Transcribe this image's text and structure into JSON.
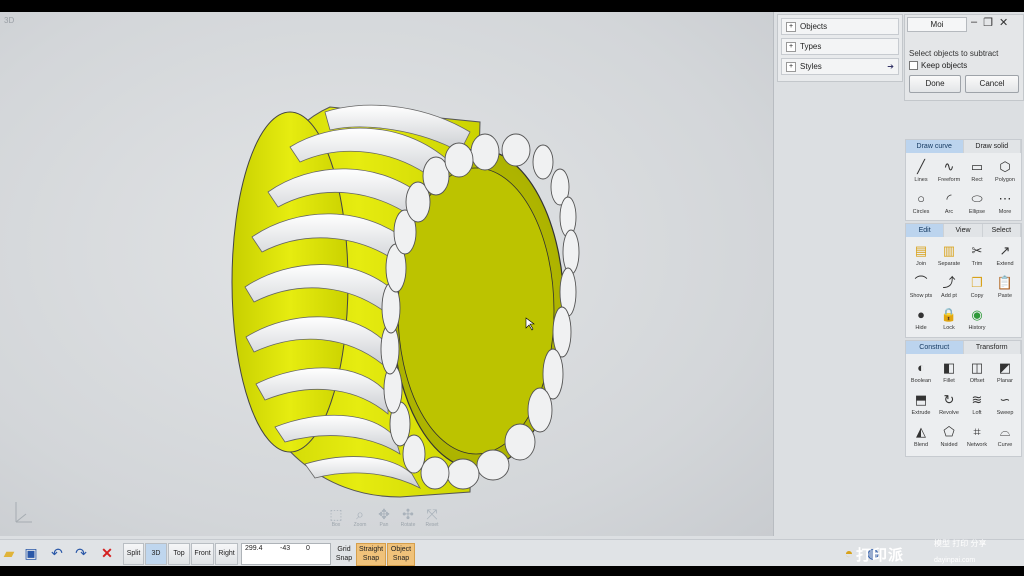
{
  "viewport": {
    "label": "3D",
    "nav_tools": [
      {
        "icon": "zoom-box-icon",
        "label": "Box"
      },
      {
        "icon": "zoom-icon",
        "label": "Zoom"
      },
      {
        "icon": "pan-icon",
        "label": "Pan"
      },
      {
        "icon": "rotate-icon",
        "label": "Rotate"
      },
      {
        "icon": "reset-icon",
        "label": "Reset"
      }
    ]
  },
  "browser": {
    "items": [
      {
        "label": "Objects"
      },
      {
        "label": "Types"
      },
      {
        "label": "Styles"
      }
    ]
  },
  "command": {
    "title": "Moi",
    "prompt": "Select objects to subtract",
    "keep_label": "Keep objects",
    "done_label": "Done",
    "cancel_label": "Cancel"
  },
  "draw": {
    "tabs": [
      "Draw curve",
      "Draw solid"
    ],
    "tools": [
      {
        "label": "Lines",
        "glyph": "╱"
      },
      {
        "label": "Freeform",
        "glyph": "∿"
      },
      {
        "label": "Rect",
        "glyph": "▭"
      },
      {
        "label": "Polygon",
        "glyph": "⬡"
      },
      {
        "label": "Circles",
        "glyph": "○"
      },
      {
        "label": "Arc",
        "glyph": "◜"
      },
      {
        "label": "Ellipse",
        "glyph": "⬭"
      },
      {
        "label": "More",
        "glyph": "⋯"
      }
    ]
  },
  "edit": {
    "tabs": [
      "Edit",
      "View",
      "Select"
    ],
    "tools": [
      {
        "label": "Join",
        "glyph": "▤"
      },
      {
        "label": "Separate",
        "glyph": "▥"
      },
      {
        "label": "Trim",
        "glyph": "✂"
      },
      {
        "label": "Extend",
        "glyph": "↗"
      },
      {
        "label": "Show pts",
        "glyph": "⌒"
      },
      {
        "label": "Add pt",
        "glyph": "⤴"
      },
      {
        "label": "Copy",
        "glyph": "❐"
      },
      {
        "label": "Paste",
        "glyph": "📋"
      },
      {
        "label": "Hide",
        "glyph": "●"
      },
      {
        "label": "Lock",
        "glyph": "🔒"
      },
      {
        "label": "History",
        "glyph": "◉"
      }
    ]
  },
  "construct": {
    "tabs": [
      "Construct",
      "Transform"
    ],
    "tools": [
      {
        "label": "Boolean",
        "glyph": "◐"
      },
      {
        "label": "Fillet",
        "glyph": "◧"
      },
      {
        "label": "Offset",
        "glyph": "◫"
      },
      {
        "label": "Planar",
        "glyph": "◩"
      },
      {
        "label": "Extrude",
        "glyph": "⬒"
      },
      {
        "label": "Revolve",
        "glyph": "↻"
      },
      {
        "label": "Loft",
        "glyph": "≋"
      },
      {
        "label": "Sweep",
        "glyph": "∽"
      },
      {
        "label": "Blend",
        "glyph": "◭"
      },
      {
        "label": "Nsided",
        "glyph": "⬠"
      },
      {
        "label": "Network",
        "glyph": "⌗"
      },
      {
        "label": "Curve",
        "glyph": "⌓"
      }
    ]
  },
  "statusbar": {
    "views": [
      "Split",
      "3D",
      "Top",
      "Front",
      "Right"
    ],
    "coords": {
      "x": "299.4",
      "y": "-43",
      "z": "0"
    },
    "grid_snap": [
      "Grid",
      "Snap"
    ],
    "straight_snap": [
      "Straight",
      "Snap"
    ],
    "object_snap": [
      "Object",
      "Snap"
    ]
  },
  "watermark": {
    "main": "打印派",
    "sub": "模型 打印 分享",
    "url": "dayinpai.com"
  },
  "colors": {
    "wheel_yellow": "#d9e000",
    "hub_olive": "#b8c000",
    "panel_active_tab": "#bcd4ee",
    "snap_orange": "#f0c27a"
  }
}
